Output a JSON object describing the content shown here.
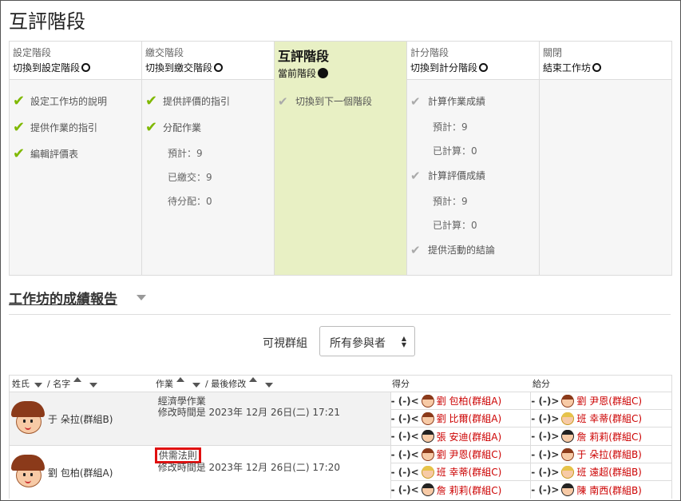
{
  "page_title": "互評階段",
  "phases": [
    {
      "name": "設定階段",
      "switch": "切換到設定階段",
      "tasks": [
        {
          "label": "設定工作坊的說明",
          "status": "done"
        },
        {
          "label": "提供作業的指引",
          "status": "done"
        },
        {
          "label": "編輯評價表",
          "status": "done"
        }
      ],
      "subs": []
    },
    {
      "name": "繳交階段",
      "switch": "切換到繳交階段",
      "tasks": [
        {
          "label": "提供評價的指引",
          "status": "done"
        },
        {
          "label": "分配作業",
          "status": "done"
        }
      ],
      "subs": [
        "預計：9",
        "已繳交：9",
        "待分配：0"
      ]
    },
    {
      "name": "互評階段",
      "switch": "當前階段",
      "tasks": [
        {
          "label": "切換到下一個階段",
          "status": "todo"
        }
      ],
      "subs": []
    },
    {
      "name": "計分階段",
      "switch": "切換到計分階段",
      "tasks": [],
      "subs": []
    },
    {
      "name": "關閉",
      "switch": "結束工作坊",
      "tasks": [],
      "subs": []
    }
  ],
  "grading_phase_items": {
    "t1": "計算作業成績",
    "s1a": "預計：9",
    "s1b": "已計算：0",
    "t2": "計算評價成績",
    "s2a": "預計：9",
    "s2b": "已計算：0",
    "t3": "提供活動的結論"
  },
  "report": {
    "title": "工作坊的成績報告",
    "group_label": "可視群組",
    "group_value": "所有參與者"
  },
  "table": {
    "h_last": "姓氏",
    "h_first": "/ 名字",
    "h_sub": "作業",
    "h_modified": "/ 最後修改",
    "h_received": "得分",
    "h_given": "給分",
    "rows": [
      {
        "name": "于 朵拉(群組B)",
        "sub_title": "經濟學作業",
        "sub_time": "修改時間是 2023年 12月 26日(二) 17:21",
        "received": [
          {
            "prefix": "- (-)<",
            "name": "劉 包柏(群組A)"
          },
          {
            "prefix": "- (-)<",
            "name": "劉 比爾(群組A)"
          },
          {
            "prefix": "- (-)<",
            "name": "張 安迪(群組A)"
          }
        ],
        "given": [
          {
            "prefix": "- (-)>",
            "name": "劉 尹恩(群組C)"
          },
          {
            "prefix": "- (-)>",
            "name": "班 幸蒂(群組C)"
          },
          {
            "prefix": "- (-)>",
            "name": "詹 莉莉(群組C)"
          }
        ]
      },
      {
        "name": "劉 包柏(群組A)",
        "sub_title": "供需法則",
        "sub_time": "修改時間是 2023年 12月 26日(二) 17:20",
        "received": [
          {
            "prefix": "- (-)<",
            "name": "劉 尹恩(群組C)"
          },
          {
            "prefix": "- (-)<",
            "name": "班 幸蒂(群組C)"
          },
          {
            "prefix": "- (-)<",
            "name": "詹 莉莉(群組C)"
          }
        ],
        "given": [
          {
            "prefix": "- (-)>",
            "name": "于 朵拉(群組B)"
          },
          {
            "prefix": "- (-)>",
            "name": "班 遠超(群組B)"
          },
          {
            "prefix": "- (-)>",
            "name": "陳 南西(群組B)"
          }
        ]
      }
    ]
  },
  "colors": {
    "active_phase": "#e8f0c4",
    "check": "#7fb800",
    "name_link": "#cc0000",
    "highlight": "#e01010"
  }
}
